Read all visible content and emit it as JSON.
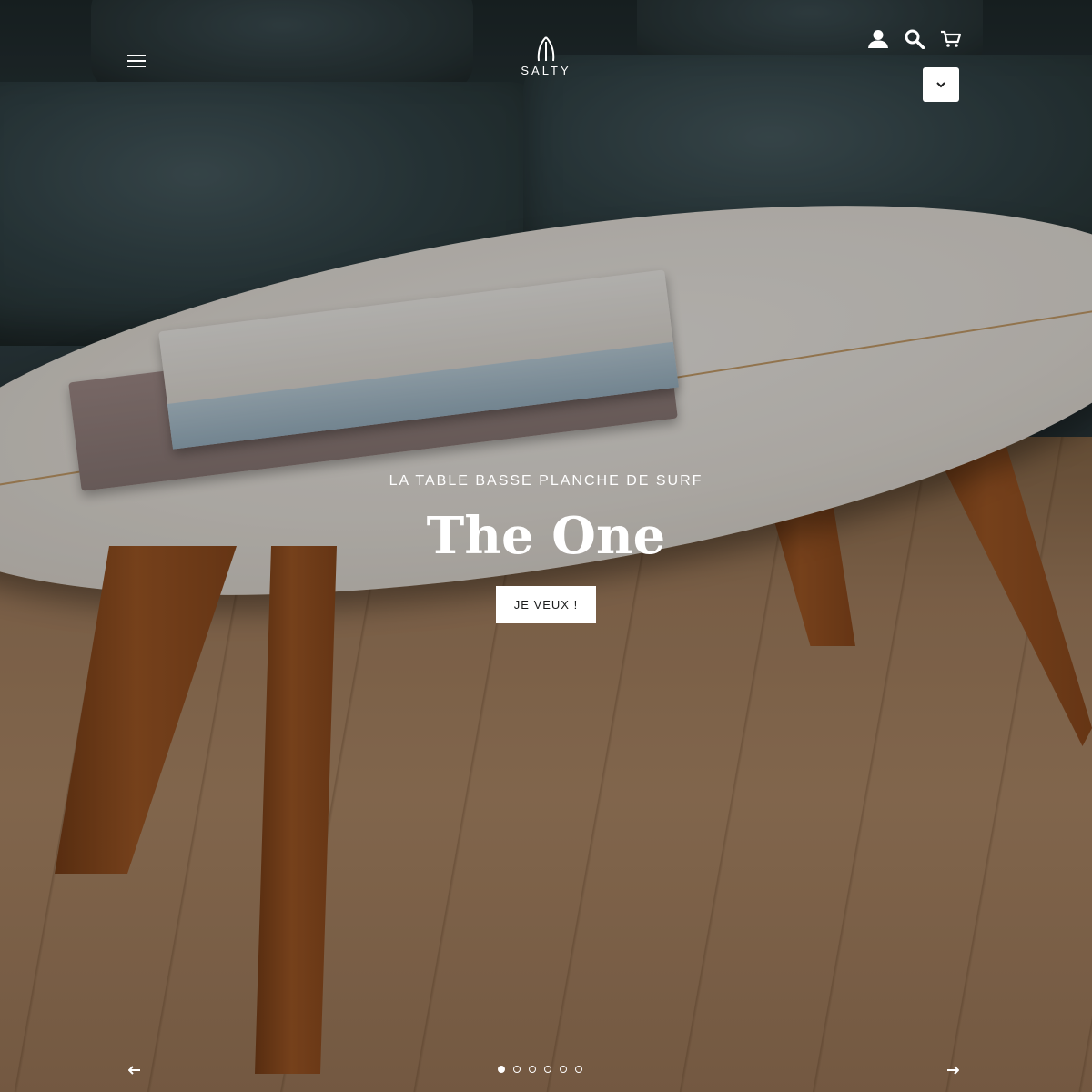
{
  "header": {
    "logo_text": "SALTY",
    "menu_icon": "hamburger-icon",
    "account_icon": "account-icon",
    "search_icon": "search-icon",
    "cart_icon": "cart-icon",
    "currency_icon": "chevron-down-icon"
  },
  "slide": {
    "subheading": "LA TABLE BASSE PLANCHE DE SURF",
    "heading": "The One",
    "button_label": "JE VEUX !"
  },
  "slider": {
    "prev_icon": "arrow-left-icon",
    "next_icon": "arrow-right-icon",
    "dots_count": 6,
    "active_index": 0
  }
}
